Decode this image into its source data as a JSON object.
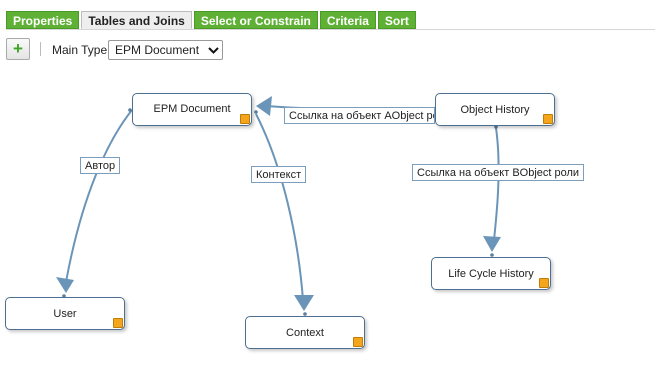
{
  "tabs": [
    {
      "label": "Properties"
    },
    {
      "label": "Tables and Joins"
    },
    {
      "label": "Select or Constrain"
    },
    {
      "label": "Criteria"
    },
    {
      "label": "Sort"
    }
  ],
  "active_tab": "Tables and Joins",
  "toolbar": {
    "add_label": "+",
    "main_type_label": "Main Type:",
    "main_type_value": "EPM Document"
  },
  "nodes": {
    "epm_document": "EPM Document",
    "object_history": "Object History",
    "life_cycle_history": "Life Cycle History",
    "user": "User",
    "context": "Context"
  },
  "edge_labels": {
    "author": "Автор",
    "context": "Контекст",
    "aobject": "Ссылка на объект AObject роли",
    "bobject": "Ссылка на объект BObject роли"
  },
  "colors": {
    "tab_green": "#5fb135",
    "edge_blue": "#6b95b8",
    "handle_orange": "#f4a51c"
  }
}
